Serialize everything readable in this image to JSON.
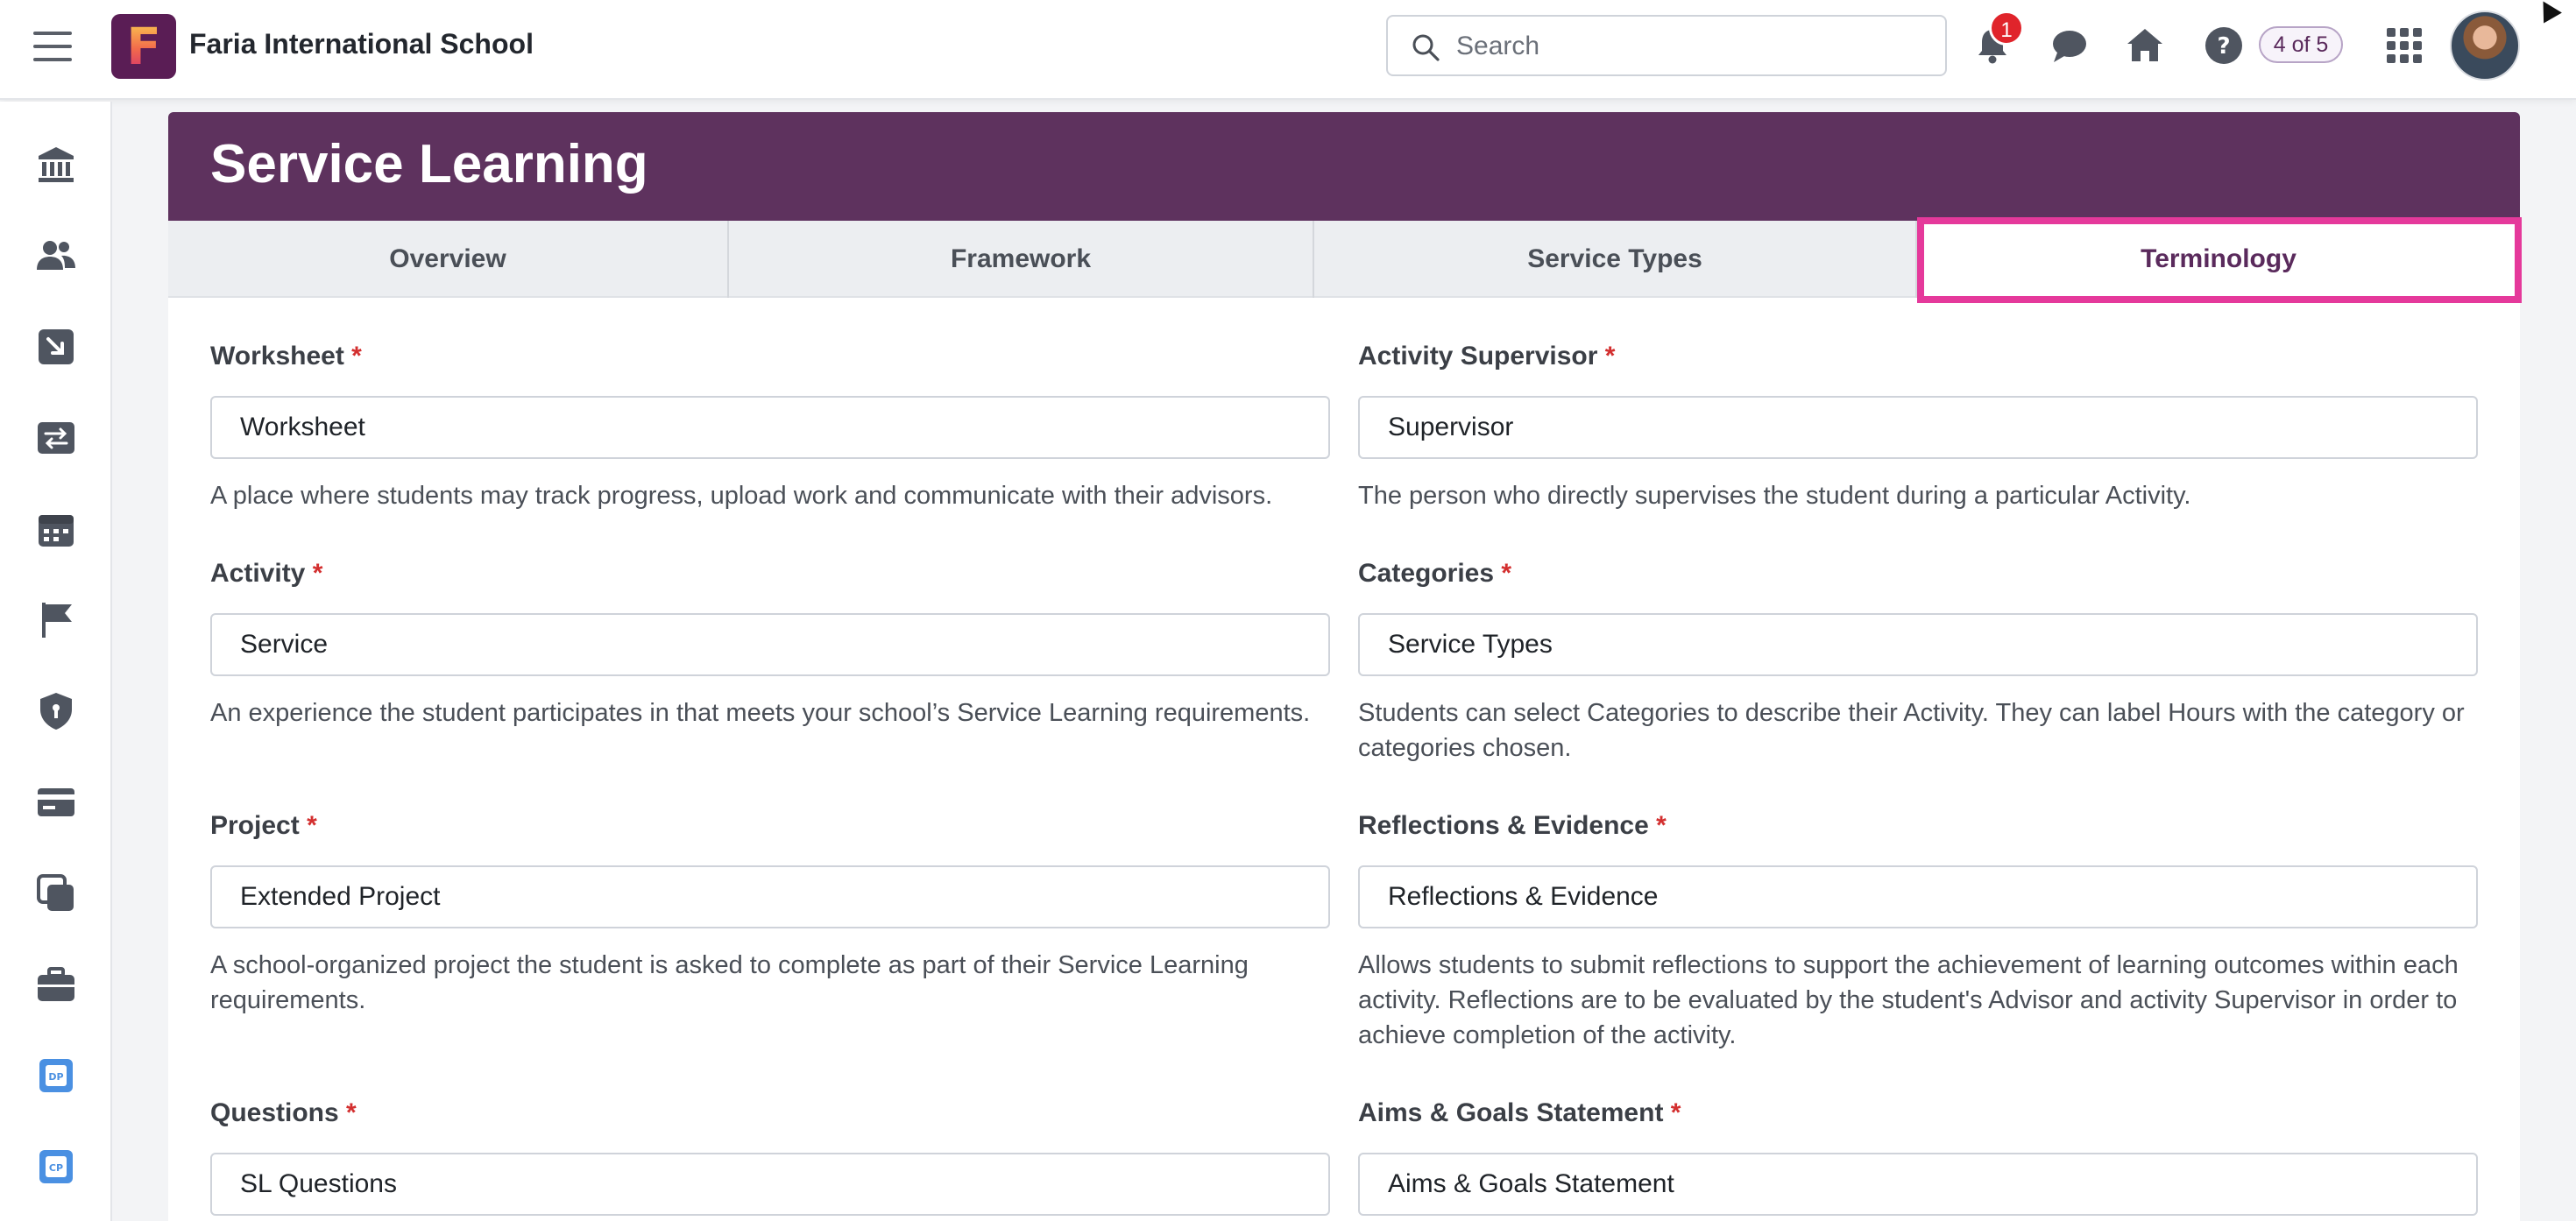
{
  "topbar": {
    "school_name": "Faria International School",
    "logo_letter": "F",
    "search_placeholder": "Search",
    "notification_count": "1",
    "page_counter": "4 of 5"
  },
  "page": {
    "title": "Service Learning",
    "tabs": [
      {
        "label": "Overview",
        "active": false
      },
      {
        "label": "Framework",
        "active": false
      },
      {
        "label": "Service Types",
        "active": false
      },
      {
        "label": "Terminology",
        "active": true
      }
    ]
  },
  "form": {
    "required_mark": "*",
    "worksheet": {
      "label": "Worksheet",
      "value": "Worksheet",
      "help": "A place where students may track progress, upload work and communicate with their advisors."
    },
    "activity_supervisor": {
      "label": "Activity Supervisor",
      "value": "Supervisor",
      "help": "The person who directly supervises the student during a particular Activity."
    },
    "activity": {
      "label": "Activity",
      "value": "Service",
      "help": "An experience the student participates in that meets your school’s Service Learning requirements."
    },
    "categories": {
      "label": "Categories",
      "value": "Service Types",
      "help": "Students can select Categories to describe their Activity. They can label Hours with the category or categories chosen."
    },
    "project": {
      "label": "Project",
      "value": "Extended Project",
      "help": "A school-organized project the student is asked to complete as part of their Service Learning requirements."
    },
    "reflections": {
      "label": "Reflections & Evidence",
      "value": "Reflections & Evidence",
      "help": "Allows students to submit reflections to support the achievement of learning outcomes within each activity. Reflections are to be evaluated by the student's Advisor and activity Supervisor in order to achieve completion of the activity."
    },
    "questions": {
      "label": "Questions",
      "value": "SL Questions"
    },
    "aims_goals": {
      "label": "Aims & Goals Statement",
      "value": "Aims & Goals Statement"
    }
  },
  "sidebar": {
    "items": [
      {
        "icon": "institution-icon"
      },
      {
        "icon": "people-icon"
      },
      {
        "icon": "arrow-in-icon"
      },
      {
        "icon": "exchange-icon"
      },
      {
        "icon": "calendar-icon"
      },
      {
        "icon": "flag-icon"
      },
      {
        "icon": "shield-icon"
      },
      {
        "icon": "card-icon"
      },
      {
        "icon": "copy-icon"
      },
      {
        "icon": "briefcase-icon"
      },
      {
        "icon": "dp-icon"
      },
      {
        "icon": "cp-icon"
      }
    ]
  },
  "colors": {
    "brand_purple": "#5e325e",
    "highlight_pink": "#e5399b",
    "required_red": "#d32f2f",
    "badge_red": "#e0242b"
  }
}
